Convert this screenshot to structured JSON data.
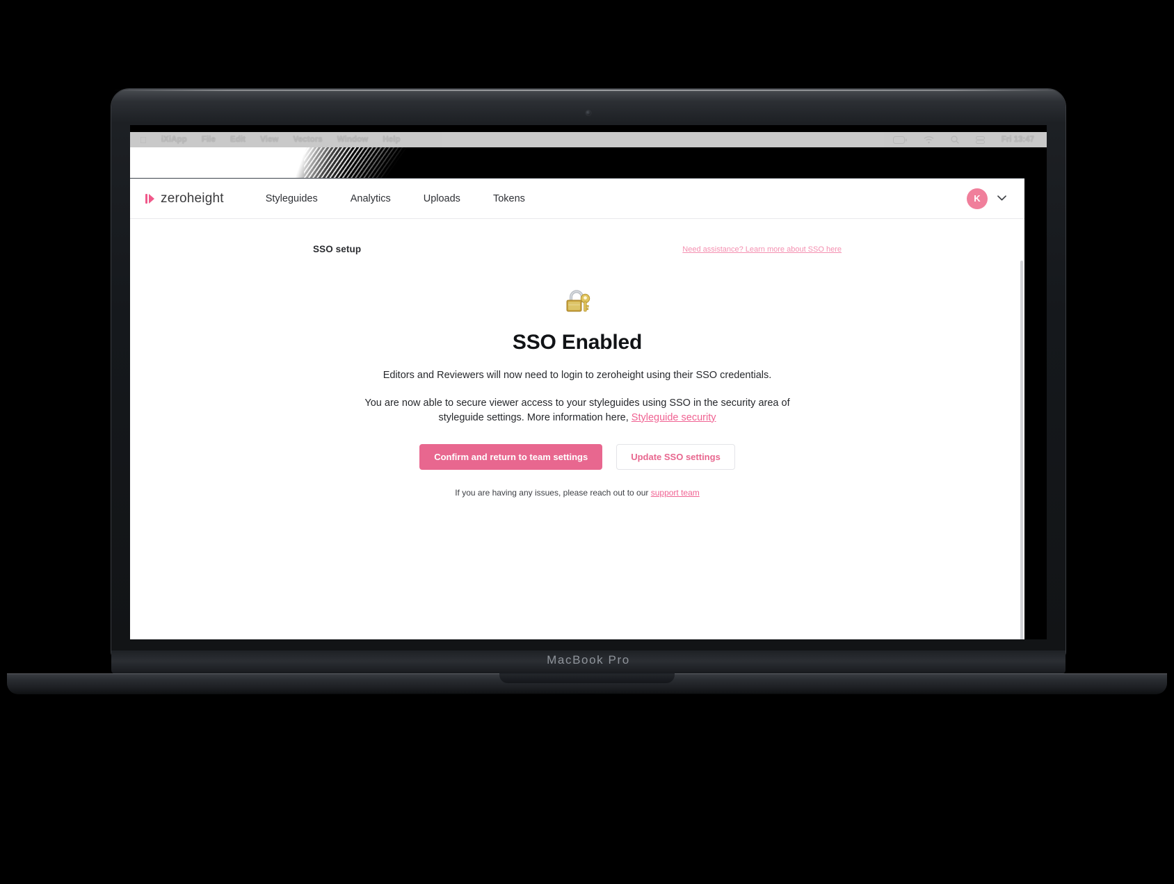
{
  "device": {
    "brand_label": "MacBook Pro"
  },
  "menubar": {
    "apple_icon": "apple-icon",
    "items": [
      "iXiApp",
      "File",
      "Edit",
      "View",
      "Vectors",
      "Window",
      "Help"
    ],
    "status_icons": [
      "battery-icon",
      "wifi-icon",
      "search-icon",
      "control-center-icon"
    ],
    "clock": "Fri 13:47"
  },
  "topnav": {
    "logo_text": "zeroheight",
    "links": [
      "Styleguides",
      "Analytics",
      "Uploads",
      "Tokens"
    ],
    "avatar_initial": "K",
    "chevron": "chevron-down-icon"
  },
  "page": {
    "title": "SSO setup",
    "help_link": "Need assistance? Learn more about SSO here",
    "hero_emoji": "locked-with-key-emoji",
    "hero_title": "SSO Enabled",
    "hero_sub": "Editors and Reviewers will now need to login to zeroheight using their SSO credentials.",
    "hero_para_lead": "You are now able to secure viewer access to your styleguides using SSO in the security area of styleguide settings. More information here,",
    "hero_para_link": "Styleguide security",
    "primary_button": "Confirm and return to team settings",
    "secondary_button": "Update SSO settings",
    "support_text": "If you are having any issues, please reach out to our",
    "support_link": "support team"
  },
  "colors": {
    "brand_pink": "#e8678f",
    "link_pink": "#f06292",
    "avatar_pink": "#f07f9b",
    "logo_pink": "#f0598a"
  }
}
